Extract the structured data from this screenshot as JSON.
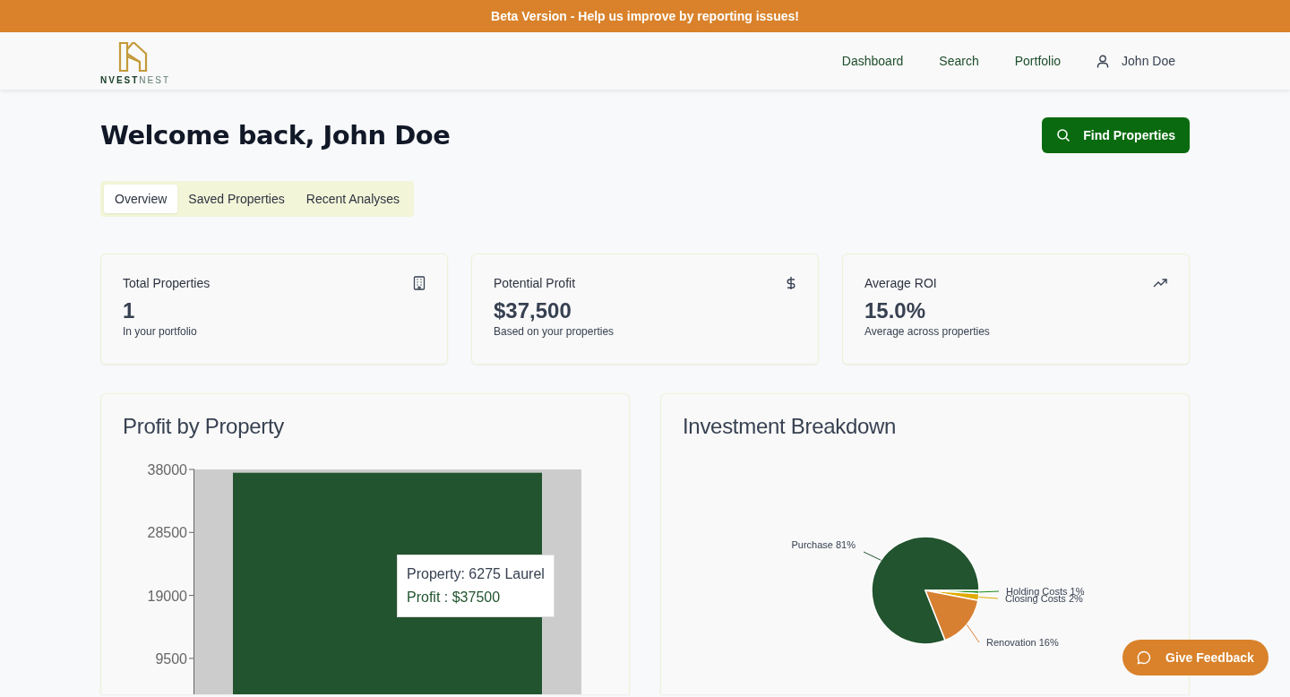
{
  "banner": {
    "text": "Beta Version - Help us improve by reporting issues!"
  },
  "header": {
    "logo_text": "**NVEST**NEST",
    "nav": [
      {
        "label": "Dashboard"
      },
      {
        "label": "Search"
      },
      {
        "label": "Portfolio"
      }
    ],
    "user": {
      "name": "John Doe"
    }
  },
  "page": {
    "title": "Welcome back, John Doe",
    "action": "Find Properties"
  },
  "tabs": [
    {
      "label": "Overview",
      "selected": true
    },
    {
      "label": "Saved Properties",
      "selected": false
    },
    {
      "label": "Recent Analyses",
      "selected": false
    }
  ],
  "stats": [
    {
      "kind": "building",
      "title": "Total Properties",
      "value": "1",
      "caption": "In your portfolio"
    },
    {
      "kind": "dollar",
      "title": "Potential Profit",
      "value": "$37,500",
      "caption": "Based on your properties"
    },
    {
      "kind": "trend",
      "title": "Average ROI",
      "value": "15.0%",
      "caption": "Average across properties"
    }
  ],
  "profit_card": {
    "title": "Profit by Property",
    "chart_data": {
      "type": "bar",
      "series": [
        {
          "color": "#22542f",
          "values": [
            37500
          ]
        }
      ],
      "ylim": [
        0,
        38000
      ],
      "yticks": [
        9500,
        19000,
        28500,
        38000
      ]
    },
    "tooltip": {
      "title": "Property: 6275 Laurel",
      "value": "Profit : $37500"
    }
  },
  "breakdown_card": {
    "title": "Investment Breakdown",
    "chart_data": {
      "type": "pie",
      "categories": [
        "Purchase 81%",
        "Holding Costs 1%",
        "Closing Costs 2%",
        "Renovation 16%"
      ],
      "series": [
        {
          "values": [
            81,
            1,
            2,
            16
          ]
        }
      ],
      "colors": [
        "#22542f",
        "#1a8a1a",
        "#e0aa00",
        "#d88032"
      ]
    }
  },
  "feedback": {
    "label": "Give Feedback"
  }
}
